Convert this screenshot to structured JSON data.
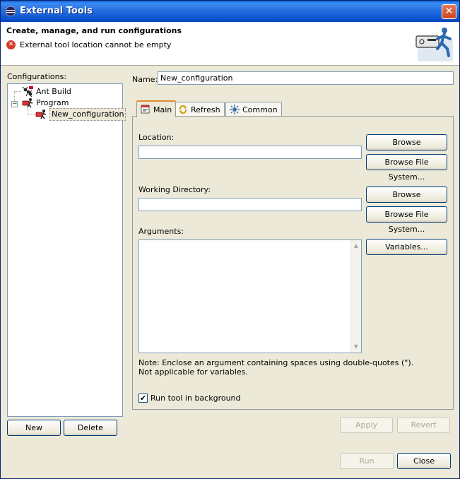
{
  "window": {
    "title": "External Tools",
    "close_glyph": "✕"
  },
  "header": {
    "title": "Create, manage, and run configurations",
    "error": "External tool location cannot be empty",
    "error_glyph": "✕",
    "graphic_icon": "external-tools-runner-graphic"
  },
  "configurations": {
    "label": "Configurations:",
    "tree": [
      {
        "label": "Ant Build",
        "icon": "ant-build-icon"
      },
      {
        "label": "Program",
        "icon": "program-icon",
        "expander": "−"
      },
      {
        "label": "New_configuration",
        "icon": "program-config-icon"
      }
    ],
    "new_label": "New",
    "delete_label": "Delete"
  },
  "name": {
    "label": "Name:",
    "value": "New_configuration"
  },
  "tabs": [
    {
      "label": "Main",
      "icon": "main-tab-icon"
    },
    {
      "label": "Refresh",
      "icon": "refresh-tab-icon"
    },
    {
      "label": "Common",
      "icon": "common-tab-icon"
    }
  ],
  "main": {
    "location_label": "Location:",
    "location_value": "",
    "working_dir_label": "Working Directory:",
    "working_dir_value": "",
    "arguments_label": "Arguments:",
    "arguments_value": "",
    "browse_workspace": "Browse Workspace...",
    "browse_filesystem": "Browse File System...",
    "variables": "Variables...",
    "note_line1": "Note: Enclose an argument containing spaces using double-quotes (\").",
    "note_line2": "Not applicable for variables.",
    "run_in_background_label": "Run tool in background",
    "run_in_background_checked": true,
    "check_glyph": "✔"
  },
  "actions": {
    "apply": "Apply",
    "revert": "Revert",
    "run": "Run",
    "close": "Close"
  },
  "colors": {
    "title_bar": "#0a55d0",
    "dialog_bg": "#ece9d8",
    "active_tab_accent": "#e68b2c",
    "error_red": "#d43d2a"
  }
}
